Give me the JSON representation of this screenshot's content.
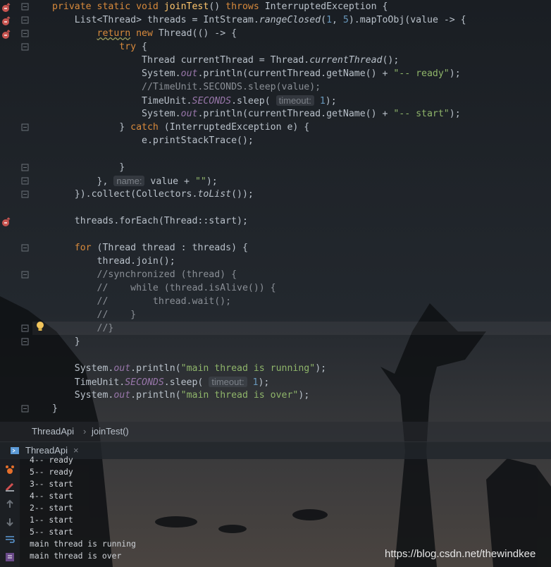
{
  "code_lines": [
    {
      "tokens": [
        [
          "kw",
          "private static void "
        ],
        [
          "fn",
          "joinTest"
        ],
        [
          "plain",
          "() "
        ],
        [
          "kw",
          "throws "
        ],
        [
          "plain",
          "InterruptedException {"
        ]
      ]
    },
    {
      "tokens": [
        [
          "plain",
          "    List<Thread> threads = IntStream."
        ],
        [
          "it",
          "rangeClosed"
        ],
        [
          "plain",
          "("
        ],
        [
          "num",
          "1"
        ],
        [
          "plain",
          ", "
        ],
        [
          "num",
          "5"
        ],
        [
          "plain",
          ").mapToObj(value -> {"
        ]
      ]
    },
    {
      "tokens": [
        [
          "plain",
          "        "
        ],
        [
          "kw warnline",
          "return"
        ],
        [
          "kw",
          " new "
        ],
        [
          "plain",
          "Thread(() -> {"
        ]
      ]
    },
    {
      "tokens": [
        [
          "kw",
          "            try "
        ],
        [
          "plain",
          "{"
        ]
      ]
    },
    {
      "tokens": [
        [
          "plain",
          "                Thread currentThread = Thread."
        ],
        [
          "it",
          "currentThread"
        ],
        [
          "plain",
          "();"
        ]
      ]
    },
    {
      "tokens": [
        [
          "plain",
          "                System."
        ],
        [
          "fld",
          "out"
        ],
        [
          "plain",
          ".println(currentThread.getName() + "
        ],
        [
          "str",
          "\"-- ready\""
        ],
        [
          "plain",
          ");"
        ]
      ]
    },
    {
      "tokens": [
        [
          "cmt",
          "                //TimeUnit.SECONDS.sleep(value);"
        ]
      ]
    },
    {
      "tokens": [
        [
          "plain",
          "                TimeUnit."
        ],
        [
          "fld",
          "SECONDS"
        ],
        [
          "plain",
          ".sleep( "
        ],
        [
          "hint",
          "timeout:"
        ],
        [
          "plain",
          " "
        ],
        [
          "num",
          "1"
        ],
        [
          "plain",
          ");"
        ]
      ]
    },
    {
      "tokens": [
        [
          "plain",
          "                System."
        ],
        [
          "fld",
          "out"
        ],
        [
          "plain",
          ".println(currentThread.getName() + "
        ],
        [
          "str",
          "\"-- start\""
        ],
        [
          "plain",
          ");"
        ]
      ]
    },
    {
      "tokens": [
        [
          "plain",
          "            } "
        ],
        [
          "kw",
          "catch "
        ],
        [
          "plain",
          "(InterruptedException e) {"
        ]
      ]
    },
    {
      "tokens": [
        [
          "plain",
          "                e.printStackTrace();"
        ]
      ]
    },
    {
      "tokens": [
        [
          "plain",
          ""
        ]
      ]
    },
    {
      "tokens": [
        [
          "plain",
          "            }"
        ]
      ]
    },
    {
      "tokens": [
        [
          "plain",
          "        }, "
        ],
        [
          "hint",
          "name:"
        ],
        [
          "plain",
          " value + "
        ],
        [
          "str",
          "\"\""
        ],
        [
          "plain",
          ");"
        ]
      ]
    },
    {
      "tokens": [
        [
          "plain",
          "    }).collect(Collectors."
        ],
        [
          "it",
          "toList"
        ],
        [
          "plain",
          "());"
        ]
      ]
    },
    {
      "tokens": [
        [
          "plain",
          ""
        ]
      ]
    },
    {
      "tokens": [
        [
          "plain",
          "    threads.forEach(Thread::start);"
        ]
      ]
    },
    {
      "tokens": [
        [
          "plain",
          ""
        ]
      ]
    },
    {
      "tokens": [
        [
          "kw",
          "    for "
        ],
        [
          "plain",
          "(Thread thread : threads) {"
        ]
      ]
    },
    {
      "tokens": [
        [
          "plain",
          "        thread.join();"
        ]
      ]
    },
    {
      "tokens": [
        [
          "cmt",
          "        //synchronized (thread) {"
        ]
      ]
    },
    {
      "tokens": [
        [
          "cmt",
          "        //    while (thread.isAlive()) {"
        ]
      ]
    },
    {
      "tokens": [
        [
          "cmt",
          "        //        thread.wait();"
        ]
      ]
    },
    {
      "tokens": [
        [
          "cmt",
          "        //    }"
        ]
      ]
    },
    {
      "tokens": [
        [
          "cmt",
          "        //}"
        ]
      ]
    },
    {
      "tokens": [
        [
          "plain",
          "    }"
        ]
      ]
    },
    {
      "tokens": [
        [
          "plain",
          ""
        ]
      ]
    },
    {
      "tokens": [
        [
          "plain",
          "    System."
        ],
        [
          "fld",
          "out"
        ],
        [
          "plain",
          ".println("
        ],
        [
          "str",
          "\"main thread is running\""
        ],
        [
          "plain",
          ");"
        ]
      ]
    },
    {
      "tokens": [
        [
          "plain",
          "    TimeUnit."
        ],
        [
          "fld",
          "SECONDS"
        ],
        [
          "plain",
          ".sleep( "
        ],
        [
          "hint",
          "timeout:"
        ],
        [
          "plain",
          " "
        ],
        [
          "num",
          "1"
        ],
        [
          "plain",
          ");"
        ]
      ]
    },
    {
      "tokens": [
        [
          "plain",
          "    System."
        ],
        [
          "fld",
          "out"
        ],
        [
          "plain",
          ".println("
        ],
        [
          "str",
          "\"main thread is over\""
        ],
        [
          "plain",
          ");"
        ]
      ]
    },
    {
      "tokens": [
        [
          "plain",
          "}"
        ]
      ]
    }
  ],
  "breadcrumb": {
    "class_name": "ThreadApi",
    "separator": "›",
    "method_name": "joinTest()"
  },
  "run_tab": {
    "label": "ThreadApi",
    "close": "×"
  },
  "console_lines": [
    "4-- ready",
    "5-- ready",
    "3-- start",
    "4-- start",
    "2-- start",
    "1-- start",
    "5-- start",
    "main thread is running",
    "main thread is over"
  ],
  "watermark": "https://blog.csdn.net/thewindkee",
  "colors": {
    "keyword": "#d88a3c",
    "method": "#ffc66d",
    "number": "#6897bb",
    "string": "#8fb56a",
    "comment": "#8a8f96",
    "field": "#9876aa"
  },
  "icons": [
    "breakpoint-override-icon",
    "fold-marker-icon",
    "lightbulb-icon",
    "run-tab-icon",
    "close-icon",
    "rerun-icon",
    "stop-icon",
    "up-icon",
    "down-icon",
    "soft-wrap-icon",
    "scroll-to-end-icon"
  ]
}
